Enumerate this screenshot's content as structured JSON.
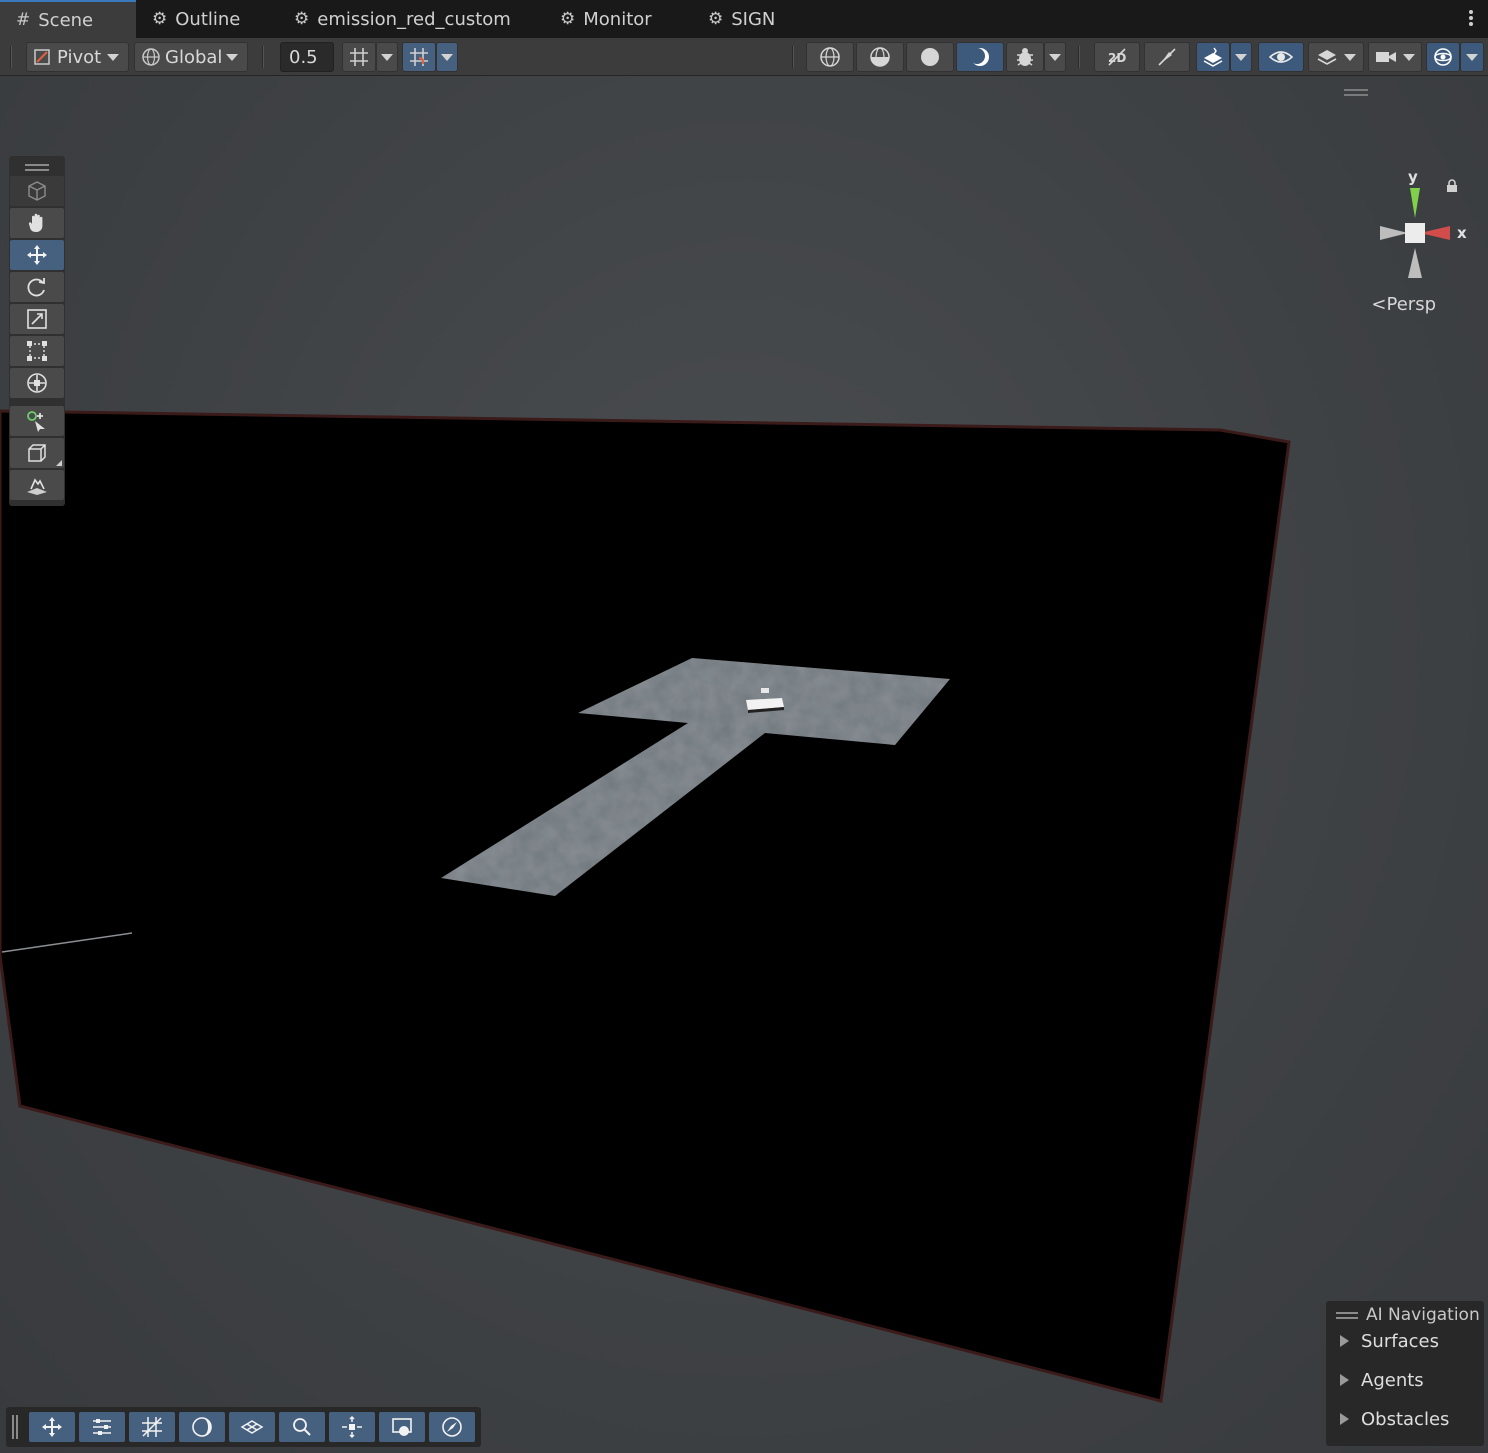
{
  "tabs": [
    {
      "label": "Scene",
      "icon": "hash-icon",
      "active": true
    },
    {
      "label": "Outline",
      "icon": "prefab-icon"
    },
    {
      "label": "emission_red_custom",
      "icon": "prefab-icon"
    },
    {
      "label": "Monitor",
      "icon": "prefab-icon"
    },
    {
      "label": "SIGN",
      "icon": "prefab-icon"
    }
  ],
  "toolbar": {
    "pivot_label": "Pivot",
    "global_label": "Global",
    "snap_value": "0.5"
  },
  "gizmo": {
    "y_label": "y",
    "x_label": "x",
    "projection_label": "Persp"
  },
  "ai_navigation": {
    "title": "AI Navigation",
    "items": [
      "Surfaces",
      "Agents",
      "Obstacles"
    ]
  },
  "colors": {
    "accent": "#46607f",
    "active_tab_border": "#3a79bb",
    "axis_y": "#7fd14a",
    "axis_x": "#d24c4c"
  }
}
